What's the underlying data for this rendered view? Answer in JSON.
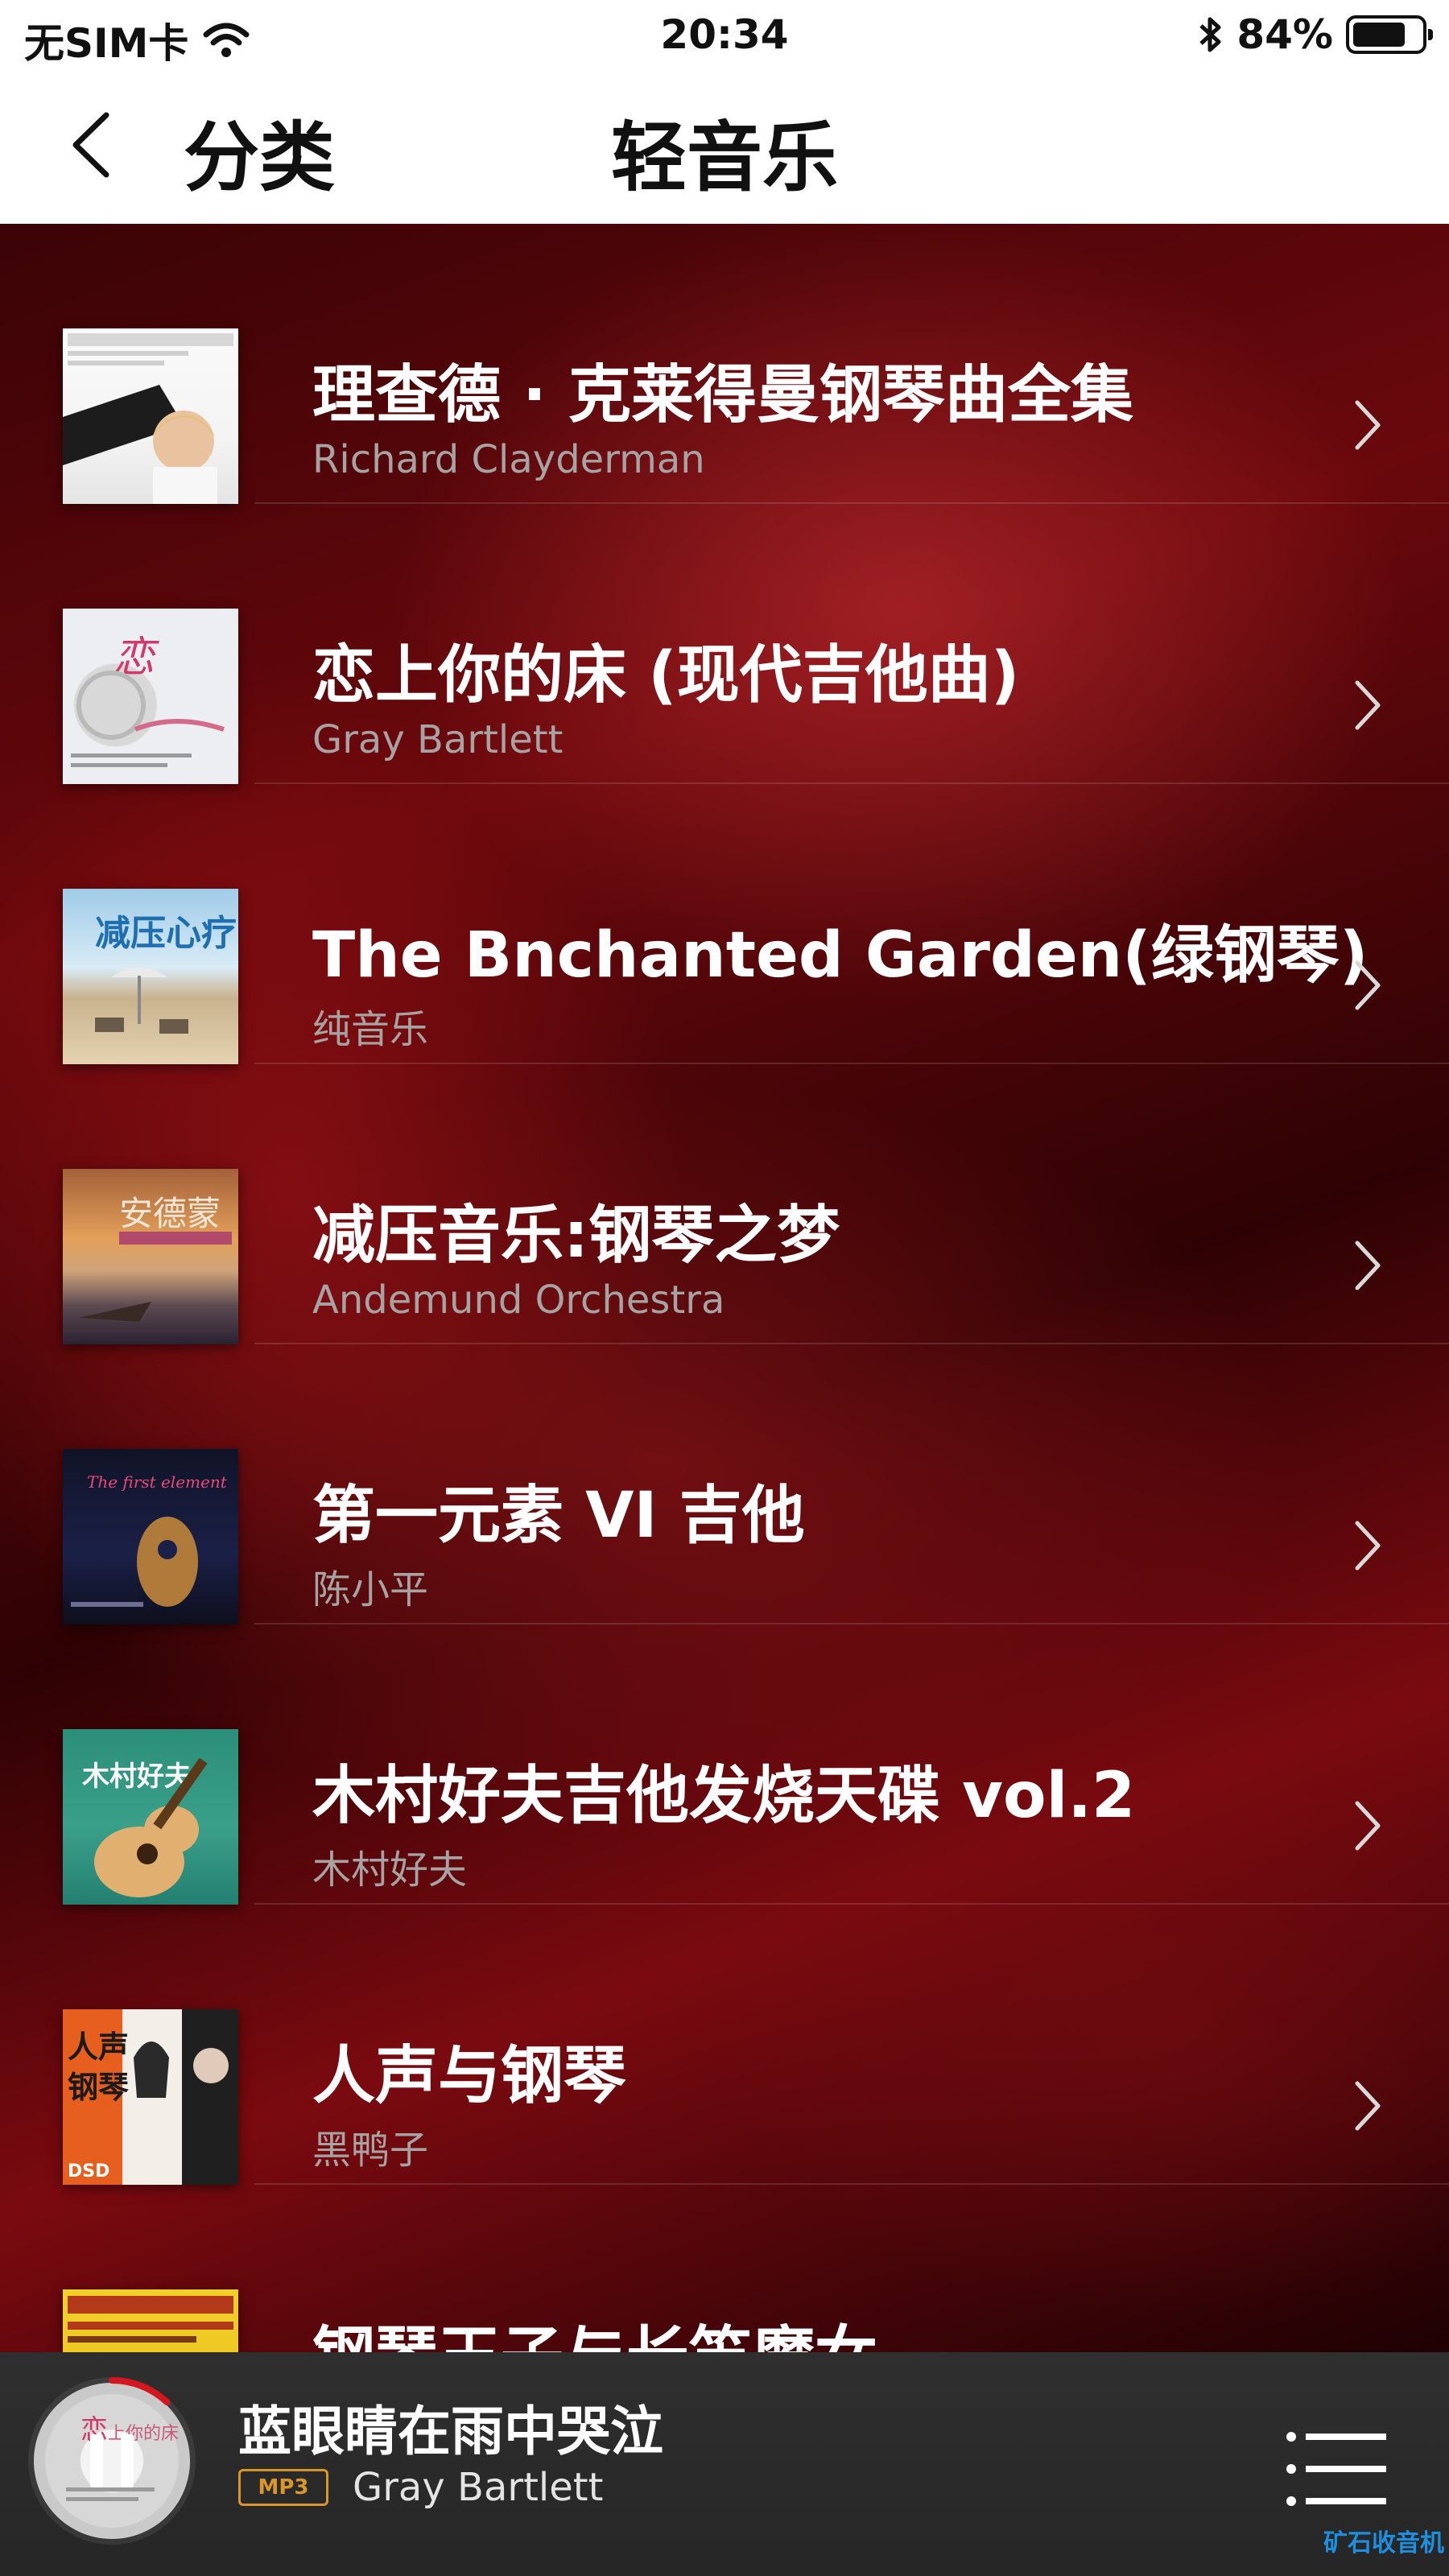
{
  "status_bar": {
    "carrier": "无SIM卡",
    "time": "20:34",
    "battery": "84%",
    "icons": [
      "wifi-icon",
      "bluetooth-icon",
      "battery-icon"
    ]
  },
  "nav": {
    "back_label": "分类",
    "title": "轻音乐"
  },
  "albums": [
    {
      "title": "理查德 · 克莱得曼钢琴曲全集",
      "artist": "Richard Clayderman"
    },
    {
      "title": "恋上你的床 (现代吉他曲)",
      "artist": "Gray Bartlett"
    },
    {
      "title": "The Bnchanted Garden(绿钢琴)",
      "artist": "纯音乐"
    },
    {
      "title": "减压音乐:钢琴之梦",
      "artist": "Andemund Orchestra"
    },
    {
      "title": "第一元素 VI 吉他",
      "artist": "陈小平"
    },
    {
      "title": "木村好夫吉他发烧天碟 vol.2",
      "artist": "木村好夫"
    },
    {
      "title": "人声与钢琴",
      "artist": "黑鸭子"
    },
    {
      "title": "钢琴王子与长笛魔女",
      "artist": ""
    }
  ],
  "player": {
    "track_title": "蓝眼睛在雨中哭泣",
    "format_badge": "MP3",
    "artist": "Gray Bartlett",
    "progress": 0.12,
    "state": "playing"
  },
  "watermark": "矿石收音机",
  "colors": {
    "accent_red": "#d6161e",
    "badge_orange": "#d9962b",
    "list_bg": "#6a080c",
    "player_bg": "#2f2f2f"
  }
}
